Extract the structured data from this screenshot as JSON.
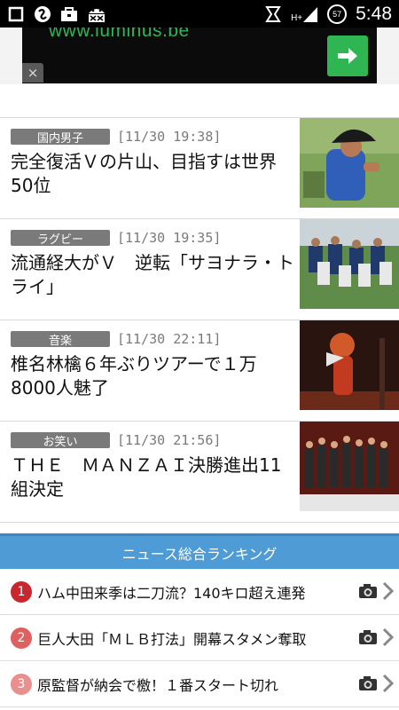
{
  "statusbar": {
    "network": "H+",
    "battery": "57",
    "time": "5:48",
    "icons": [
      "square-icon",
      "s-circle-icon",
      "briefcase-icon",
      "android-icon",
      "data-icon",
      "signal-icon",
      "battery-icon"
    ]
  },
  "ad": {
    "url_text": "www.luminus.be",
    "close_label": "×",
    "go_icon": "arrow-right-icon"
  },
  "news": [
    {
      "category": "国内男子",
      "date": "[11/30 19:38]",
      "headline": "完全復活Ｖの片山、目指すは世界50位"
    },
    {
      "category": "ラグビー",
      "date": "[11/30 19:35]",
      "headline": "流通経大がＶ　逆転「サヨナラ・トライ」"
    },
    {
      "category": "音楽",
      "date": "[11/30 22:11]",
      "headline": "椎名林檎６年ぶりツアーで１万8000人魅了"
    },
    {
      "category": "お笑い",
      "date": "[11/30 21:56]",
      "headline": "ＴＨＥ　ＭＡＮＺＡＩ決勝進出11組決定"
    }
  ],
  "ranking": {
    "title": "ニュース総合ランキング",
    "items": [
      {
        "rank": "1",
        "color": "#c8282d",
        "title": "ハム中田来季は二刀流？140キロ超え連発"
      },
      {
        "rank": "2",
        "color": "#e06060",
        "title": "巨人大田「ＭＬＢ打法」開幕スタメン奪取"
      },
      {
        "rank": "3",
        "color": "#e9908e",
        "title": "原監督が納会で檄！１番スタート切れ"
      }
    ]
  },
  "colors": {
    "accent": "#4f9bd6",
    "category_bg": "#7a7a7a",
    "ad_green": "#2fb551"
  }
}
